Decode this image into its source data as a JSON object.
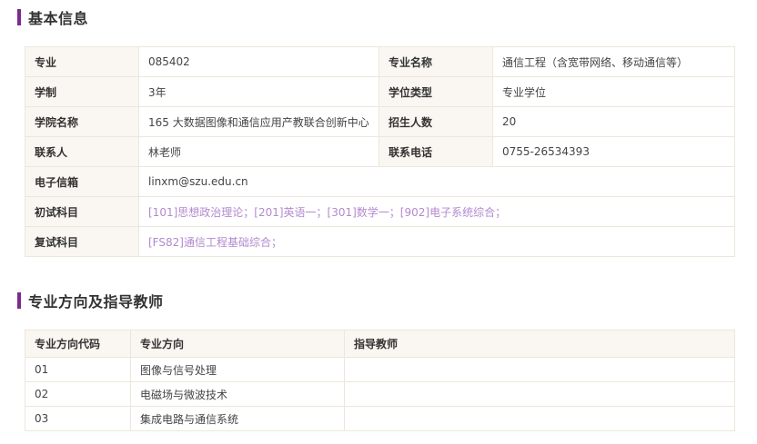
{
  "basic": {
    "title": "基本信息",
    "rows": [
      [
        {
          "label": "专业",
          "value": "085402"
        },
        {
          "label": "专业名称",
          "value": "通信工程（含宽带网络、移动通信等）"
        }
      ],
      [
        {
          "label": "学制",
          "value": "3年"
        },
        {
          "label": "学位类型",
          "value": "专业学位"
        }
      ],
      [
        {
          "label": "学院名称",
          "value": "165 大数据图像和通信应用产教联合创新中心"
        },
        {
          "label": "招生人数",
          "value": "20"
        }
      ],
      [
        {
          "label": "联系人",
          "value": "林老师"
        },
        {
          "label": "联系电话",
          "value": "0755-26534393"
        }
      ]
    ],
    "email": {
      "label": "电子信箱",
      "value": "linxm@szu.edu.cn"
    },
    "prelim": {
      "label": "初试科目",
      "value": "[101]思想政治理论；[201]英语一；[301]数学一；[902]电子系统综合；"
    },
    "retest": {
      "label": "复试科目",
      "value": "[FS82]通信工程基础综合；"
    }
  },
  "directions": {
    "title": "专业方向及指导教师",
    "headers": [
      "专业方向代码",
      "专业方向",
      "指导教师"
    ],
    "rows": [
      {
        "code": "01",
        "name": "图像与信号处理",
        "advisor": ""
      },
      {
        "code": "02",
        "name": "电磁场与微波技术",
        "advisor": ""
      },
      {
        "code": "03",
        "name": "集成电路与通信系统",
        "advisor": ""
      }
    ]
  },
  "colors": {
    "accent": "#7b2a8f",
    "link": "#b389cf",
    "label_bg": "#faf7f2",
    "border": "#ede6dc"
  }
}
